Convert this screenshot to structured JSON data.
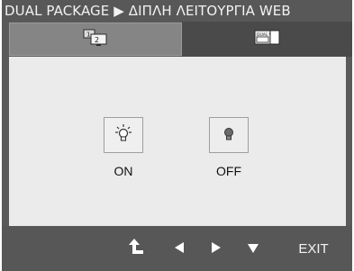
{
  "header": {
    "title": "DUAL PACKAGE ▶ ΔΙΠΛΗ ΛΕΙΤΟΥΡΓΙΑ WEB"
  },
  "tabs": [
    {
      "icon": "dual-monitor-icon"
    },
    {
      "icon": "dual-web-icon",
      "icon_text": "DUAL WEB"
    }
  ],
  "options": [
    {
      "label": "ON",
      "icon": "bulb-on-icon"
    },
    {
      "label": "OFF",
      "icon": "bulb-off-icon"
    }
  ],
  "footer": {
    "buttons": [
      {
        "icon": "return-icon"
      },
      {
        "icon": "left-arrow-icon"
      },
      {
        "icon": "right-arrow-icon"
      },
      {
        "icon": "down-arrow-icon"
      }
    ],
    "exit_label": "EXIT"
  },
  "colors": {
    "panel": "#5a5a5a",
    "content": "#ebebeb",
    "active_tab": "#858585",
    "inactive_tab": "#4a4a4a"
  }
}
